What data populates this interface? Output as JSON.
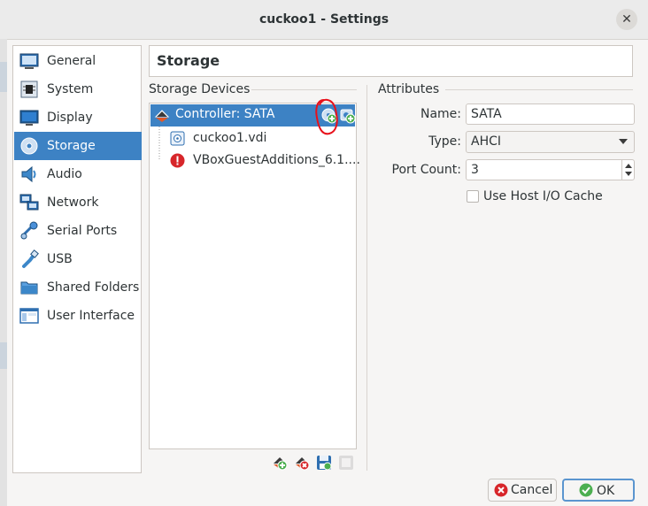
{
  "window": {
    "title": "cuckoo1 - Settings",
    "close_glyph": "✕"
  },
  "sidebar": {
    "items": [
      {
        "label": "General",
        "icon": "general-icon"
      },
      {
        "label": "System",
        "icon": "system-icon"
      },
      {
        "label": "Display",
        "icon": "display-icon"
      },
      {
        "label": "Storage",
        "icon": "storage-icon",
        "selected": true
      },
      {
        "label": "Audio",
        "icon": "audio-icon"
      },
      {
        "label": "Network",
        "icon": "network-icon"
      },
      {
        "label": "Serial Ports",
        "icon": "serial-ports-icon"
      },
      {
        "label": "USB",
        "icon": "usb-icon"
      },
      {
        "label": "Shared Folders",
        "icon": "shared-folders-icon"
      },
      {
        "label": "User Interface",
        "icon": "user-interface-icon"
      }
    ]
  },
  "page": {
    "title": "Storage"
  },
  "storage_devices": {
    "label": "Storage Devices",
    "controller": {
      "label": "Controller: SATA"
    },
    "attachments": [
      {
        "label": "cuckoo1.vdi",
        "icon": "hard-disk-icon"
      },
      {
        "label": "VBoxGuestAdditions_6.1....",
        "icon": "error-icon"
      }
    ]
  },
  "attributes": {
    "label": "Attributes",
    "name_label": "Name:",
    "name_value": "SATA",
    "type_label": "Type:",
    "type_value": "AHCI",
    "port_count_label": "Port Count:",
    "port_count_value": "3",
    "host_io_cache_label": "Use Host I/O Cache",
    "host_io_cache_checked": false
  },
  "buttons": {
    "cancel_label": "Cancel",
    "ok_label": "OK"
  },
  "colors": {
    "selection": "#3d82c4",
    "annotation": "#e8101a",
    "accent_green": "#4caf50"
  }
}
